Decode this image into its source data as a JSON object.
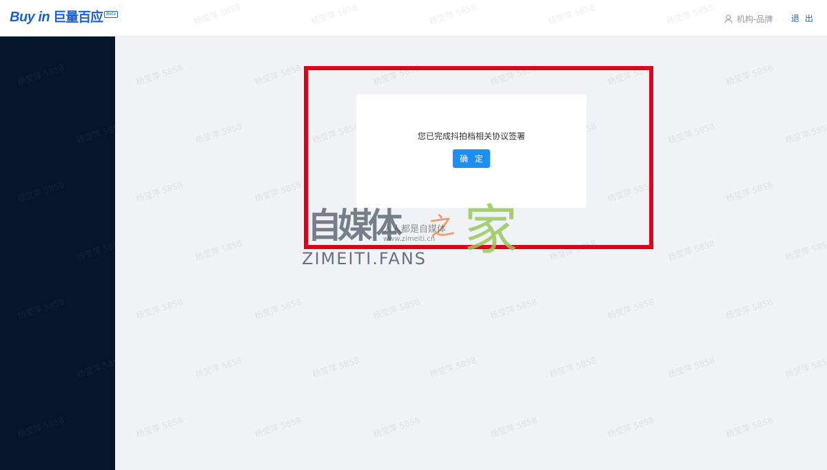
{
  "header": {
    "logo": {
      "en": "Buy in",
      "cn": "巨量百应",
      "badge": "Beta"
    },
    "user": {
      "icon": "user-icon",
      "name": "机构-品牌"
    },
    "logout_label": "退 出"
  },
  "watermark": {
    "text": "杨莹萍 5858"
  },
  "dialog": {
    "message": "您已完成抖拍档相关协议签署",
    "confirm_label": "确 定"
  },
  "overlay_logo": {
    "cn": "自媒体",
    "jia": "家",
    "zhi": "之",
    "en": "ZIMEITI.FANS",
    "small_text": "人人都是自媒体",
    "url": "www.zimeiti.cn"
  },
  "colors": {
    "brand": "#1a62d0",
    "sidebar": "#04152c",
    "button": "#1e8ef7",
    "highlight": "#e0001a",
    "page_bg": "#f0f2f5"
  }
}
